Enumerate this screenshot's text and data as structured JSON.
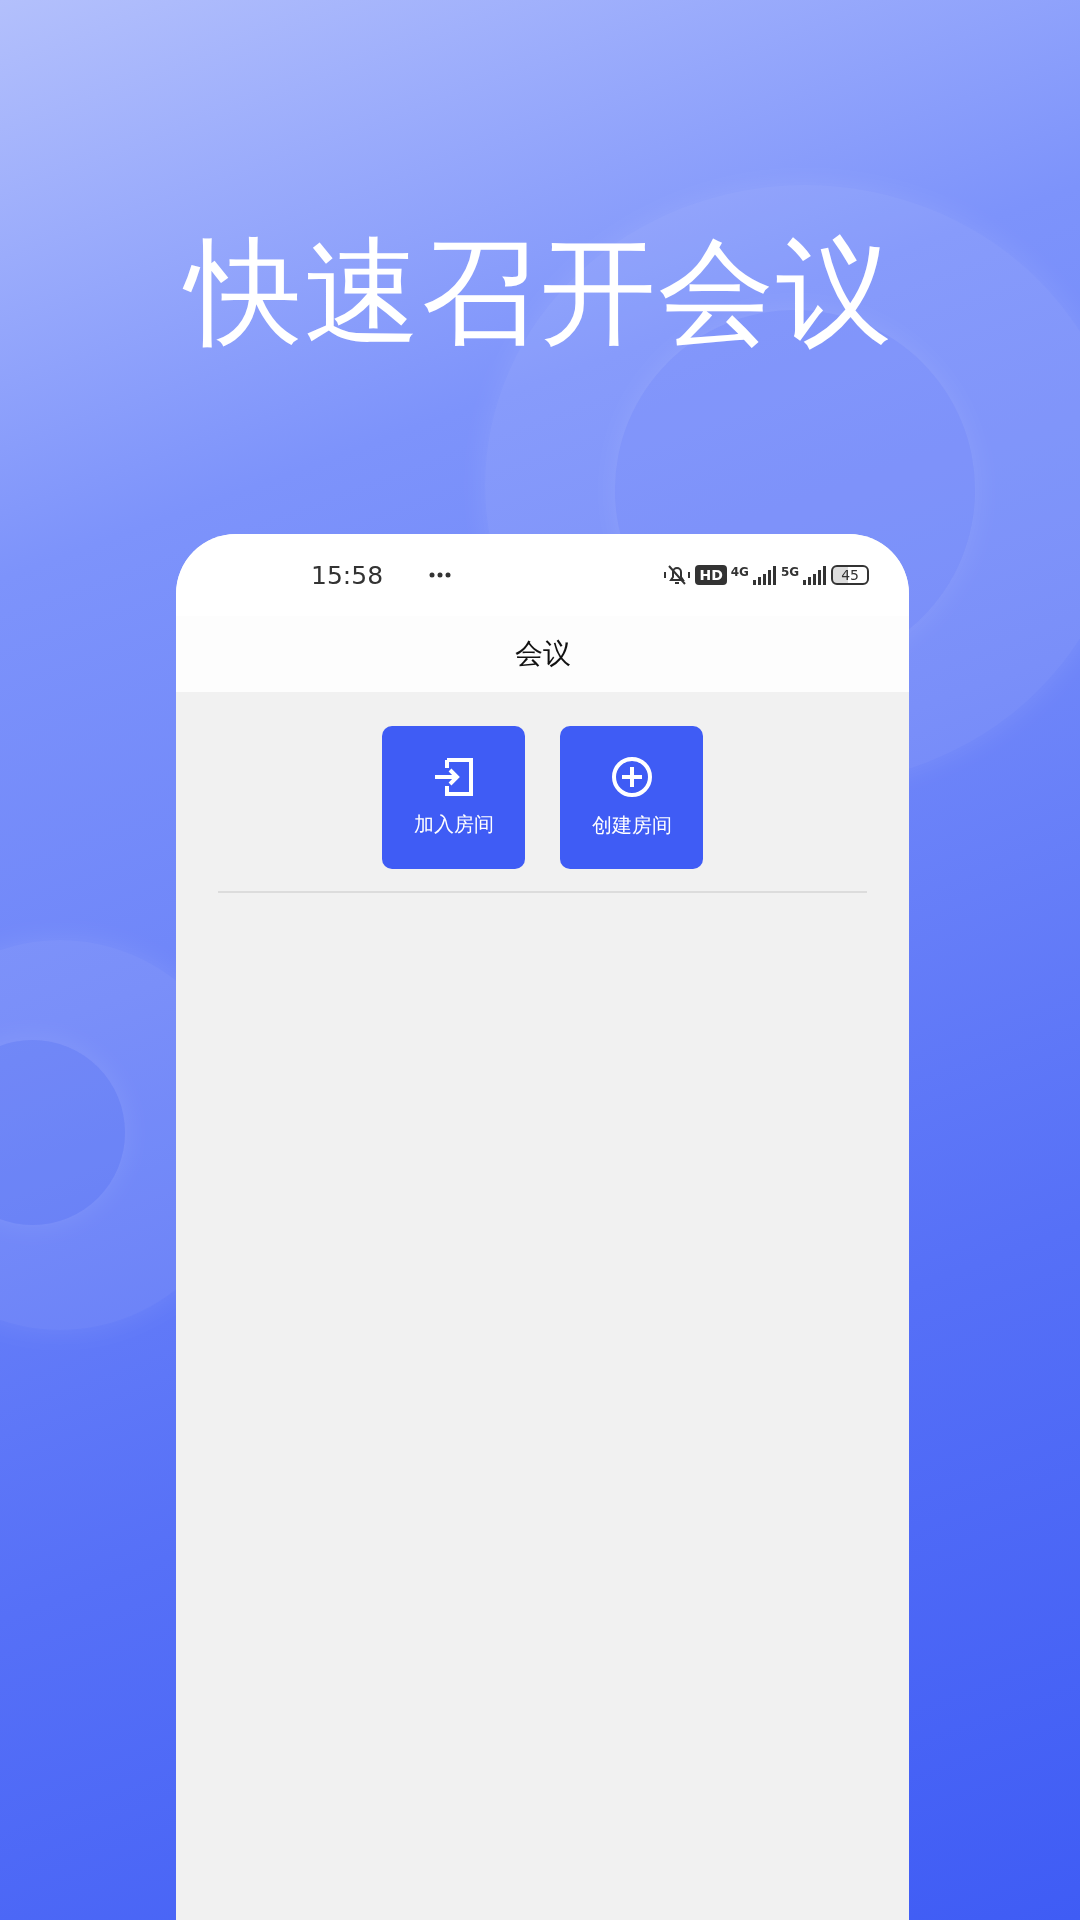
{
  "headline": "快速召开会议",
  "status_bar": {
    "time": "15:58",
    "hd": "HD",
    "network_1": "4G",
    "network_2": "5G",
    "battery": "45"
  },
  "title": "会议",
  "actions": [
    {
      "kind": "join",
      "label": "加入房间"
    },
    {
      "kind": "create",
      "label": "创建房间"
    }
  ]
}
